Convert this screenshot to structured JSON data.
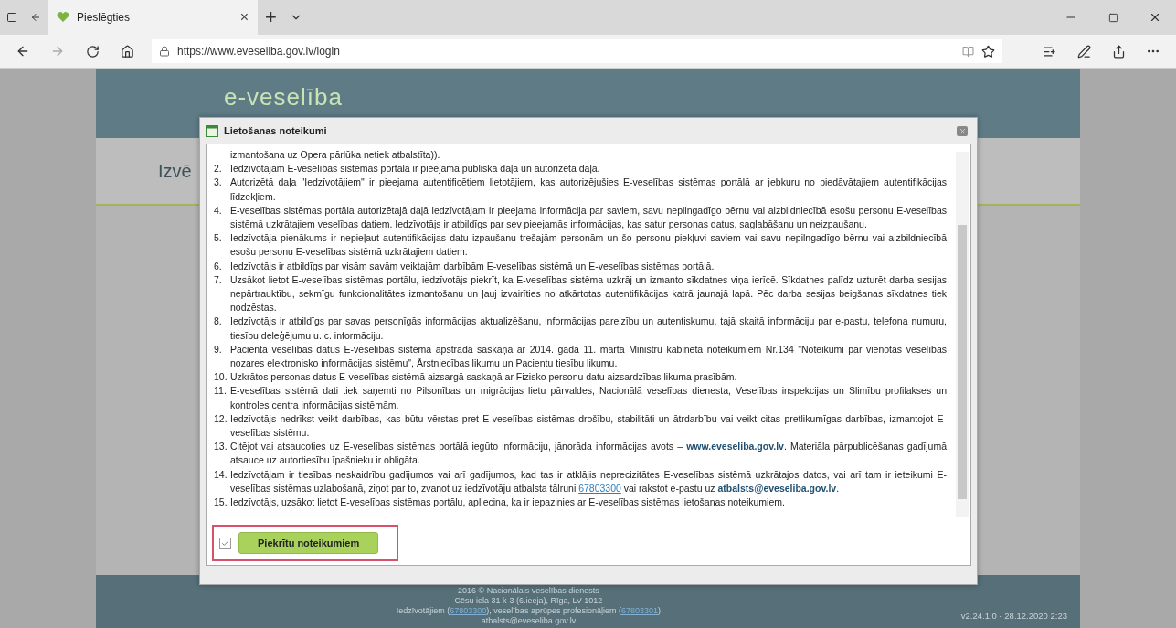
{
  "browser": {
    "tab": {
      "title": "Pieslēgties",
      "close": "×"
    },
    "new_tab": "+",
    "address": "https://www.eveseliba.gov.lv/login"
  },
  "page": {
    "logo": "e-veselība",
    "heading": "Izvē",
    "footer": [
      [
        {
          "kind": "text",
          "text": "2016 © Nacionālais veselības dienests"
        }
      ],
      [
        {
          "kind": "text",
          "text": "Cēsu iela 31 k-3 (6.ieeja), Rīga, LV-1012"
        }
      ],
      [
        {
          "kind": "text",
          "text": "Iedzīvotājiem ("
        },
        {
          "kind": "link",
          "text": "67803300"
        },
        {
          "kind": "text",
          "text": "), veselības aprūpes profesionāļiem ("
        },
        {
          "kind": "link",
          "text": "67803301"
        },
        {
          "kind": "text",
          "text": ")"
        }
      ],
      [
        {
          "kind": "text",
          "text": "atbalsts@eveseliba.gov.lv"
        }
      ]
    ],
    "version": "v2.24.1.0 - 28.12.2020 2:23"
  },
  "dialog": {
    "title": "Lietošanas noteikumi",
    "terms": [
      {
        "segments": [
          {
            "kind": "text",
            "text": "izmantošana uz Opera pārlūka netiek atbalstīta))."
          }
        ]
      },
      {
        "number": "2.",
        "segments": [
          {
            "kind": "text",
            "text": "Iedzīvotājam E-veselības sistēmas portālā ir pieejama publiskā daļa un autorizētā daļa."
          }
        ]
      },
      {
        "number": "3.",
        "segments": [
          {
            "kind": "text",
            "text": "Autorizētā daļa \"Iedzīvotājiem\" ir pieejama autentificētiem lietotājiem, kas autorizējušies E-veselības sistēmas portālā ar jebkuru no piedāvātajiem autentifikācijas līdzekļiem."
          }
        ]
      },
      {
        "number": "4.",
        "segments": [
          {
            "kind": "text",
            "text": "E-veselības sistēmas portāla autorizētajā daļā iedzīvotājam ir pieejama informācija par saviem, savu nepilngadīgo bērnu vai aizbildniecībā esošu personu E-veselības sistēmā uzkrātajiem veselības datiem. Iedzīvotājs ir atbildīgs par sev pieejamās informācijas, kas satur personas datus, saglabāšanu un neizpaušanu."
          }
        ]
      },
      {
        "number": "5.",
        "segments": [
          {
            "kind": "text",
            "text": "Iedzīvotāja pienākums ir nepieļaut autentifikācijas datu izpaušanu trešajām personām un šo personu piekļuvi saviem vai savu nepilngadīgo bērnu vai aizbildniecībā esošu personu E-veselības sistēmā uzkrātajiem datiem."
          }
        ]
      },
      {
        "number": "6.",
        "segments": [
          {
            "kind": "text",
            "text": "Iedzīvotājs ir atbildīgs par visām savām veiktajām darbībām E-veselības sistēmā un E-veselības sistēmas portālā."
          }
        ]
      },
      {
        "number": "7.",
        "segments": [
          {
            "kind": "text",
            "text": "Uzsākot lietot E-veselības sistēmas portālu, iedzīvotājs piekrīt, ka E-veselības sistēma uzkrāj un izmanto sīkdatnes viņa ierīcē. Sīkdatnes palīdz uzturēt darba sesijas nepārtrauktību, sekmīgu funkcionalitātes izmantošanu un ļauj izvairīties no atkārtotas autentifikācijas katrā jaunajā lapā. Pēc darba sesijas beigšanas sīkdatnes tiek nodzēstas."
          }
        ]
      },
      {
        "number": "8.",
        "segments": [
          {
            "kind": "text",
            "text": "Iedzīvotājs ir atbildīgs par savas personīgās informācijas aktualizēšanu, informācijas pareizību un autentiskumu, tajā skaitā informāciju par e-pastu, telefona numuru, tiesību deleģējumu u. c. informāciju."
          }
        ]
      },
      {
        "number": "9.",
        "segments": [
          {
            "kind": "text",
            "text": "Pacienta veselības datus E-veselības sistēmā apstrādā saskaņā ar 2014. gada 11. marta Ministru kabineta noteikumiem Nr.134 \"Noteikumi par vienotās veselības nozares elektronisko informācijas sistēmu\", Ārstniecības likumu un Pacientu tiesību likumu."
          }
        ]
      },
      {
        "number": "10.",
        "segments": [
          {
            "kind": "text",
            "text": "Uzkrātos personas datus E-veselības sistēmā aizsargā saskaņā ar Fizisko personu datu aizsardzības likuma prasībām."
          }
        ]
      },
      {
        "number": "11.",
        "segments": [
          {
            "kind": "text",
            "text": "E-veselības sistēmā dati tiek saņemti no Pilsonības un migrācijas lietu pārvaldes, Nacionālā veselības dienesta, Veselības inspekcijas un Slimību profilakses un kontroles centra informācijas sistēmām."
          }
        ]
      },
      {
        "number": "12.",
        "segments": [
          {
            "kind": "text",
            "text": "Iedzīvotājs nedrīkst veikt darbības, kas būtu vērstas pret E-veselības sistēmas drošību, stabilitāti un ātrdarbību vai veikt citas pretlikumīgas darbības, izmantojot E-veselības sistēmu."
          }
        ]
      },
      {
        "number": "13.",
        "segments": [
          {
            "kind": "text",
            "text": "Citējot vai atsaucoties uz E-veselības sistēmas portālā iegūto informāciju, jānorāda informācijas avots – "
          },
          {
            "kind": "strong-link",
            "text": "www.eveseliba.gov.lv"
          },
          {
            "kind": "text",
            "text": ". Materiāla pārpublicēšanas gadījumā atsauce uz autortiesību īpašnieku ir obligāta."
          }
        ]
      },
      {
        "number": "14.",
        "segments": [
          {
            "kind": "text",
            "text": "Iedzīvotājam ir tiesības neskaidrību gadījumos vai arī gadījumos, kad tas ir atklājis neprecizitātes E-veselības sistēmā uzkrātajos datos, vai arī tam ir ieteikumi E-veselības sistēmas uzlabošanā, ziņot par to, zvanot uz iedzīvotāju atbalsta tālruni "
          },
          {
            "kind": "link",
            "text": "67803300"
          },
          {
            "kind": "text",
            "text": " vai rakstot e-pastu uz "
          },
          {
            "kind": "strong-link",
            "text": "atbalsts@eveseliba.gov.lv"
          },
          {
            "kind": "text",
            "text": "."
          }
        ]
      },
      {
        "number": "15.",
        "segments": [
          {
            "kind": "text",
            "text": "Iedzīvotājs, uzsākot lietot E-veselības sistēmas portālu, apliecina, ka ir iepazinies ar E-veselības sistēmas lietošanas noteikumiem."
          }
        ]
      }
    ],
    "agree": {
      "checked": true,
      "button": "Piekrītu noteikumiem"
    }
  }
}
